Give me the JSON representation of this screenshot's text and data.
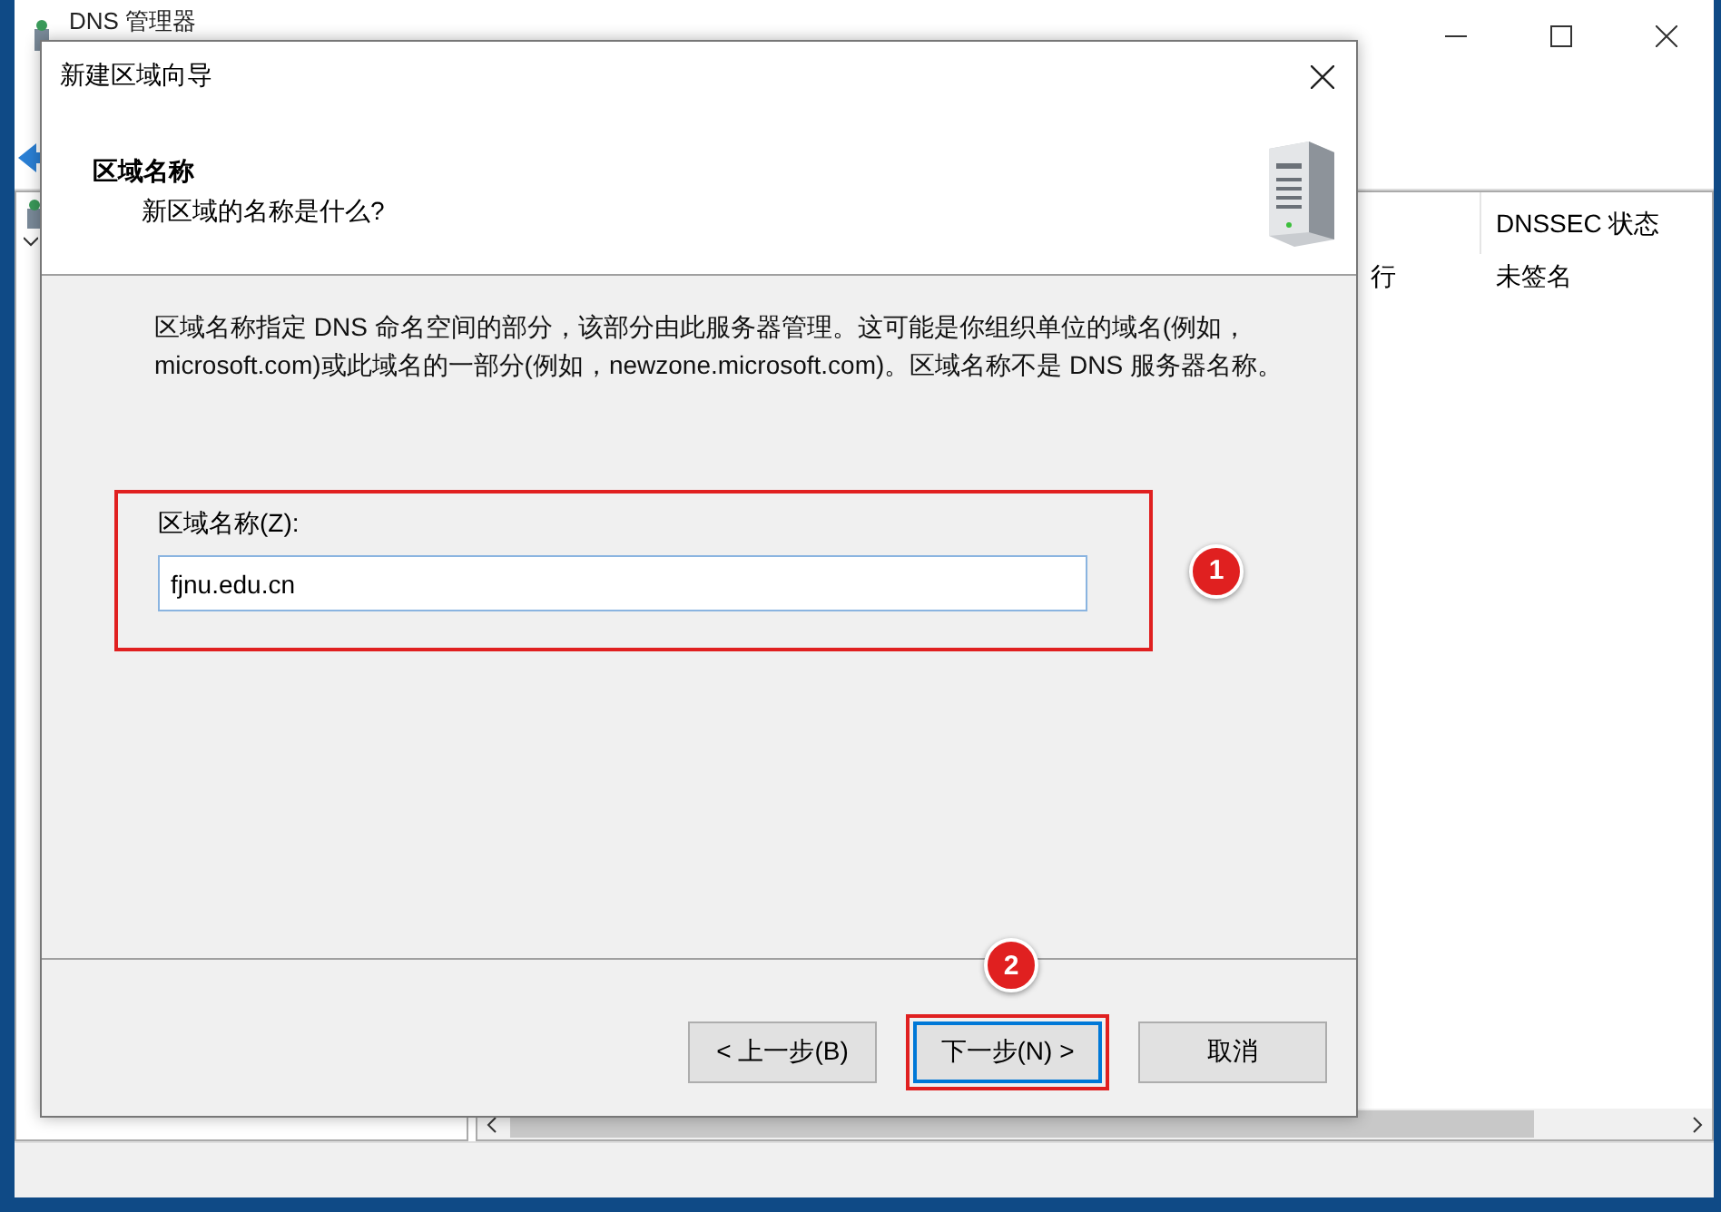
{
  "main_window": {
    "title": "DNS 管理器",
    "list": {
      "columns": [
        "",
        "DNSSEC 状态"
      ],
      "rows": [
        {
          "cells": [
            "行",
            "未签名"
          ]
        }
      ]
    }
  },
  "dialog": {
    "title": "新建区域向导",
    "heading": "区域名称",
    "subheading": "新区域的名称是什么?",
    "description": "区域名称指定 DNS 命名空间的部分，该部分由此服务器管理。这可能是你组织单位的域名(例如，microsoft.com)或此域名的一部分(例如，newzone.microsoft.com)。区域名称不是 DNS 服务器名称。",
    "field": {
      "label": "区域名称(Z):",
      "value": "fjnu.edu.cn",
      "highlighted": true,
      "badge": "1"
    },
    "buttons": [
      {
        "label": "< 上一步(B)",
        "default": false,
        "highlighted": false
      },
      {
        "label": "下一步(N) >",
        "default": true,
        "highlighted": true,
        "badge": "2"
      },
      {
        "label": "取消",
        "default": false,
        "highlighted": false
      }
    ]
  }
}
